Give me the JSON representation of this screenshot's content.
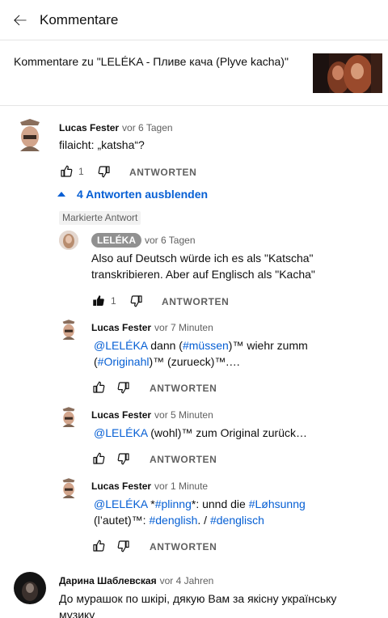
{
  "appbar": {
    "title": "Kommentare"
  },
  "video": {
    "label": "Kommentare zu \"LELÉKA - Пливе кача (Plyve kacha)\""
  },
  "top_comment": {
    "author": "Lucas Fester",
    "age": "vor 6 Tagen",
    "text": "filaicht: „katsha“?",
    "likes": "1",
    "reply_label": "ANTWORTEN"
  },
  "replies_toggle": {
    "label": "4 Antworten ausblenden"
  },
  "pinned": {
    "badge": "Markierte Antwort",
    "author": "LELÉKA",
    "age": "vor 6 Tagen",
    "text": "Also auf Deutsch würde ich es als \"Katscha\" transkribieren. Aber auf Englisch als \"Kacha\"",
    "likes": "1",
    "reply_label": "ANTWORTEN"
  },
  "replies": [
    {
      "author": "Lucas Fester",
      "age": "vor 7 Minuten",
      "mention": "@LELÉKA",
      "t1": " dann (",
      "tag1": "#müssen",
      "t2": ")™ wiehr zumm (",
      "tag2": "#Originahl",
      "t3": ")™ (zurueck)™.…",
      "reply_label": "ANTWORTEN"
    },
    {
      "author": "Lucas Fester",
      "age": "vor 5 Minuten",
      "mention": "@LELÉKA",
      "t1": " (wohl)™ zum Original zurück…",
      "reply_label": "ANTWORTEN"
    },
    {
      "author": "Lucas Fester",
      "age": "vor 1 Minute",
      "mention": "@LELÉKA",
      "t1": " *",
      "tag1": "#plinng",
      "t2": "*: unnd die ",
      "tag2": "#Løhsunng",
      "t3": " (l’autet)™: ",
      "tag3": "#denglish",
      "t4": ". / ",
      "tag4": "#denglisch",
      "reply_label": "ANTWORTEN"
    }
  ],
  "last_comment": {
    "author": "Дарина Шаблевская",
    "age": "vor 4 Jahren",
    "text": "До мурашок по шкірі, дякую Вам за якісну українську музику"
  }
}
